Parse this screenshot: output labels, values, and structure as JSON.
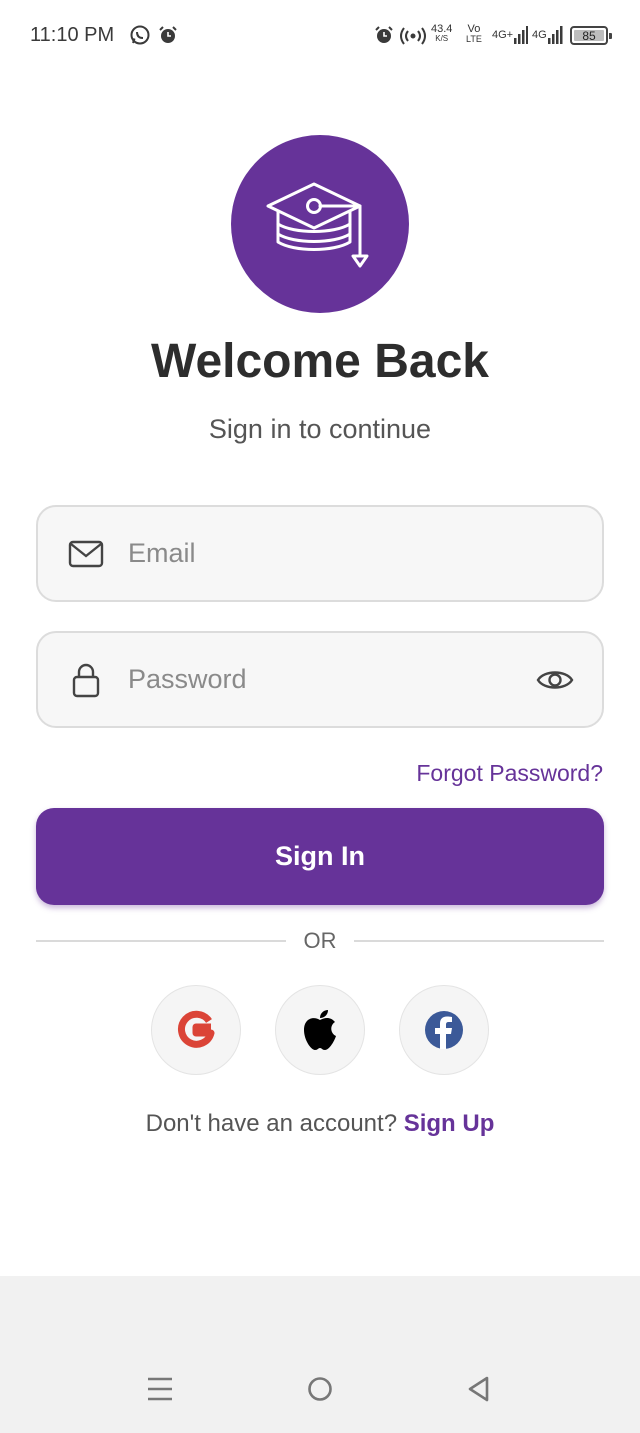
{
  "status_bar": {
    "time": "11:10 PM",
    "net_speed": "43.4",
    "net_speed_unit": "K/S",
    "volte_top": "Vo",
    "volte_bottom": "LTE",
    "sim1_label": "4G+",
    "sim2_label": "4G",
    "battery": "85",
    "icons": [
      "whatsapp-icon",
      "alarm-icon",
      "alarm-icon",
      "hotspot-icon",
      "signal-icon",
      "battery-icon"
    ]
  },
  "logo": {
    "icon": "graduation-cap-icon",
    "color": "#663399"
  },
  "title": "Welcome Back",
  "subtitle": "Sign in to continue",
  "email": {
    "placeholder": "Email",
    "value": "",
    "icon": "mail-icon"
  },
  "password": {
    "placeholder": "Password",
    "value": "",
    "icon": "lock-icon",
    "toggle_icon": "eye-icon"
  },
  "forgot_label": "Forgot Password?",
  "signin_label": "Sign In",
  "or_label": "OR",
  "social": [
    {
      "name": "google",
      "icon": "google-icon"
    },
    {
      "name": "apple",
      "icon": "apple-icon"
    },
    {
      "name": "facebook",
      "icon": "facebook-icon"
    }
  ],
  "signup": {
    "prompt": "Don't have an account?",
    "link": "Sign Up"
  },
  "nav_bar": {
    "icons": [
      "menu-icon",
      "home-icon",
      "back-icon"
    ]
  },
  "colors": {
    "accent": "#663399",
    "field_bg": "#f7f7f7",
    "field_border": "#dcdcdc"
  }
}
